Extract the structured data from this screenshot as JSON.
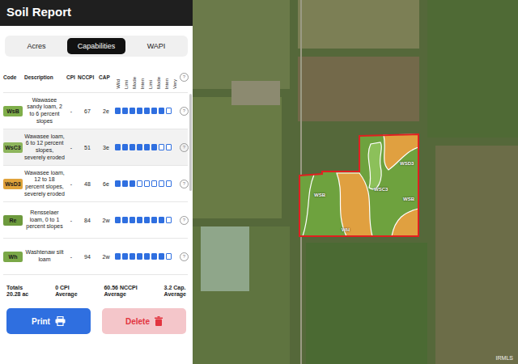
{
  "header": {
    "title": "Soil Report"
  },
  "tabs": [
    {
      "label": "Acres",
      "selected": false
    },
    {
      "label": "Capabilities",
      "selected": true
    },
    {
      "label": "WAPI",
      "selected": false
    }
  ],
  "columns": {
    "code": "Code",
    "description": "Description",
    "cpi": "CPI",
    "nccpi": "NCCPI",
    "cap": "CAP",
    "help": "?",
    "classes": [
      "Wild",
      "Limi",
      "Mode",
      "Inten",
      "Limi",
      "Mode",
      "Inten",
      "Very"
    ]
  },
  "rows": [
    {
      "code": "WsB",
      "description": "Wawasee sandy loam, 2 to 6 percent slopes",
      "cpi": "-",
      "nccpi": "67",
      "cap": "2e",
      "level": 0.875,
      "help": "?",
      "color": "#7fae4a",
      "highlighted": false
    },
    {
      "code": "WsC3",
      "description": "Wawasee loam, 6 to 12 percent slopes, severely eroded",
      "cpi": "-",
      "nccpi": "51",
      "cap": "3e",
      "level": 0.75,
      "help": "?",
      "color": "#8db55c",
      "highlighted": true
    },
    {
      "code": "WsD3",
      "description": "Wawasee loam, 12 to 18 percent slopes, severely eroded",
      "cpi": "-",
      "nccpi": "48",
      "cap": "6e",
      "level": 0.375,
      "help": "?",
      "color": "#e0a33b",
      "highlighted": false
    },
    {
      "code": "Re",
      "description": "Rensselaer loam, 0 to 1 percent slopes",
      "cpi": "-",
      "nccpi": "84",
      "cap": "2w",
      "level": 0.875,
      "help": "?",
      "color": "#6d9a3d",
      "highlighted": false
    },
    {
      "code": "Wh",
      "description": "Washtenaw silt loam",
      "cpi": "-",
      "nccpi": "94",
      "cap": "2w",
      "level": 0.875,
      "help": "?",
      "color": "#7aa847",
      "highlighted": false
    }
  ],
  "totals": {
    "label": "Totals",
    "acres": "20.28 ac",
    "items": [
      {
        "value": "0 CPI",
        "caption": "Average"
      },
      {
        "value": "60.56 NCCPI",
        "caption": "Average"
      },
      {
        "value": "3.2 Cap.",
        "caption": "Average"
      }
    ]
  },
  "buttons": [
    {
      "label": "Print",
      "kind": "primary"
    },
    {
      "label": "Delete",
      "kind": "danger"
    }
  ],
  "map": {
    "labels": [
      "WSB",
      "WSC3",
      "WSD3",
      "WSB",
      "WH"
    ],
    "watermark": "IRMLS"
  }
}
